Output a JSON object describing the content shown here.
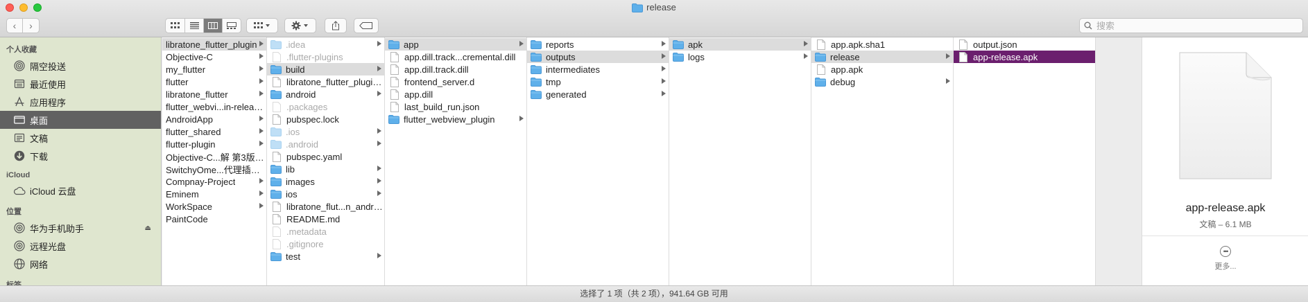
{
  "window": {
    "title": "release"
  },
  "search": {
    "placeholder": "搜索"
  },
  "sidebar": {
    "sections": [
      {
        "title": "个人收藏",
        "items": [
          {
            "label": "隔空投送",
            "icon": "airdrop-icon"
          },
          {
            "label": "最近使用",
            "icon": "recents-icon"
          },
          {
            "label": "应用程序",
            "icon": "applications-icon"
          },
          {
            "label": "桌面",
            "icon": "desktop-icon",
            "selected": true
          },
          {
            "label": "文稿",
            "icon": "documents-icon"
          },
          {
            "label": "下载",
            "icon": "downloads-icon"
          }
        ]
      },
      {
        "title": "iCloud",
        "items": [
          {
            "label": "iCloud 云盘",
            "icon": "icloud-icon"
          }
        ]
      },
      {
        "title": "位置",
        "items": [
          {
            "label": "华为手机助手",
            "icon": "disk-icon",
            "eject": true
          },
          {
            "label": "远程光盘",
            "icon": "disc-icon"
          },
          {
            "label": "网络",
            "icon": "network-icon"
          }
        ]
      },
      {
        "title": "标签",
        "items": []
      }
    ]
  },
  "columns": [
    {
      "width": 151,
      "items": [
        {
          "label": "libratone_flutter_plugin",
          "kind": "none",
          "arrow": true,
          "state": "path"
        },
        {
          "label": "Objective-C",
          "kind": "none",
          "arrow": true
        },
        {
          "label": "my_flutter",
          "kind": "none",
          "arrow": true
        },
        {
          "label": "flutter",
          "kind": "none",
          "arrow": true
        },
        {
          "label": "libratone_flutter",
          "kind": "none",
          "arrow": true
        },
        {
          "label": "flutter_webvi...in-release.aar",
          "kind": "none",
          "arrow": false
        },
        {
          "label": "AndroidApp",
          "kind": "none",
          "arrow": true
        },
        {
          "label": "flutter_shared",
          "kind": "none",
          "arrow": true
        },
        {
          "label": "flutter-plugin",
          "kind": "none",
          "arrow": true
        },
        {
          "label": "Objective-C...解 第3版.pdf",
          "kind": "none",
          "arrow": false
        },
        {
          "label": "SwitchyOme...代理插件.crx",
          "kind": "none",
          "arrow": false
        },
        {
          "label": "Compnay-Project",
          "kind": "none",
          "arrow": true
        },
        {
          "label": "Eminem",
          "kind": "none",
          "arrow": true
        },
        {
          "label": "WorkSpace",
          "kind": "none",
          "arrow": true
        },
        {
          "label": "PaintCode",
          "kind": "none",
          "arrow": false
        }
      ]
    },
    {
      "width": 170,
      "items": [
        {
          "label": ".idea",
          "kind": "folder",
          "arrow": true,
          "dim": true
        },
        {
          "label": ".flutter-plugins",
          "kind": "doc",
          "arrow": false,
          "dim": true
        },
        {
          "label": "build",
          "kind": "folder",
          "arrow": true,
          "state": "path"
        },
        {
          "label": "libratone_flutter_plugin.iml",
          "kind": "doc",
          "arrow": false
        },
        {
          "label": "android",
          "kind": "folder",
          "arrow": true
        },
        {
          "label": ".packages",
          "kind": "doc",
          "arrow": false,
          "dim": true
        },
        {
          "label": "pubspec.lock",
          "kind": "doc",
          "arrow": false
        },
        {
          "label": ".ios",
          "kind": "folder",
          "arrow": true,
          "dim": true
        },
        {
          "label": ".android",
          "kind": "folder",
          "arrow": true,
          "dim": true
        },
        {
          "label": "pubspec.yaml",
          "kind": "doc",
          "arrow": false
        },
        {
          "label": "lib",
          "kind": "folder",
          "arrow": true
        },
        {
          "label": "images",
          "kind": "folder",
          "arrow": true
        },
        {
          "label": "ios",
          "kind": "folder",
          "arrow": true
        },
        {
          "label": "libratone_flut...n_android.iml",
          "kind": "doc",
          "arrow": false
        },
        {
          "label": "README.md",
          "kind": "doc",
          "arrow": false
        },
        {
          "label": ".metadata",
          "kind": "doc",
          "arrow": false,
          "dim": true
        },
        {
          "label": ".gitignore",
          "kind": "doc",
          "arrow": false,
          "dim": true
        },
        {
          "label": "test",
          "kind": "folder",
          "arrow": true
        }
      ]
    },
    {
      "width": 205,
      "items": [
        {
          "label": "app",
          "kind": "folder",
          "arrow": true,
          "state": "path"
        },
        {
          "label": "app.dill.track...cremental.dill",
          "kind": "doc",
          "arrow": false
        },
        {
          "label": "app.dill.track.dill",
          "kind": "doc",
          "arrow": false
        },
        {
          "label": "frontend_server.d",
          "kind": "doc",
          "arrow": false
        },
        {
          "label": "app.dill",
          "kind": "doc",
          "arrow": false
        },
        {
          "label": "last_build_run.json",
          "kind": "doc",
          "arrow": false
        },
        {
          "label": "flutter_webview_plugin",
          "kind": "folder",
          "arrow": true
        }
      ]
    },
    {
      "width": 205,
      "items": [
        {
          "label": "reports",
          "kind": "folder",
          "arrow": true
        },
        {
          "label": "outputs",
          "kind": "folder",
          "arrow": true,
          "state": "path"
        },
        {
          "label": "intermediates",
          "kind": "folder",
          "arrow": true
        },
        {
          "label": "tmp",
          "kind": "folder",
          "arrow": true
        },
        {
          "label": "generated",
          "kind": "folder",
          "arrow": true
        }
      ]
    },
    {
      "width": 205,
      "items": [
        {
          "label": "apk",
          "kind": "folder",
          "arrow": true,
          "state": "path"
        },
        {
          "label": "logs",
          "kind": "folder",
          "arrow": true
        }
      ]
    },
    {
      "width": 205,
      "items": [
        {
          "label": "app.apk.sha1",
          "kind": "doc",
          "arrow": false
        },
        {
          "label": "release",
          "kind": "folder",
          "arrow": true,
          "state": "path"
        },
        {
          "label": "app.apk",
          "kind": "doc",
          "arrow": false
        },
        {
          "label": "debug",
          "kind": "folder",
          "arrow": true
        }
      ]
    },
    {
      "width": 205,
      "items": [
        {
          "label": "output.json",
          "kind": "doc",
          "arrow": false
        },
        {
          "label": "app-release.apk",
          "kind": "doc",
          "arrow": false,
          "state": "sel"
        }
      ]
    }
  ],
  "preview": {
    "filename": "app-release.apk",
    "info": "文稿 – 6.1 MB",
    "more": "更多..."
  },
  "status": {
    "text": "选择了 1 项（共 2 项），941.64 GB 可用"
  },
  "colors": {
    "selection": "#6b1f6e",
    "sidebar": "#dfe6cf",
    "folder": "#5fb0ea"
  }
}
